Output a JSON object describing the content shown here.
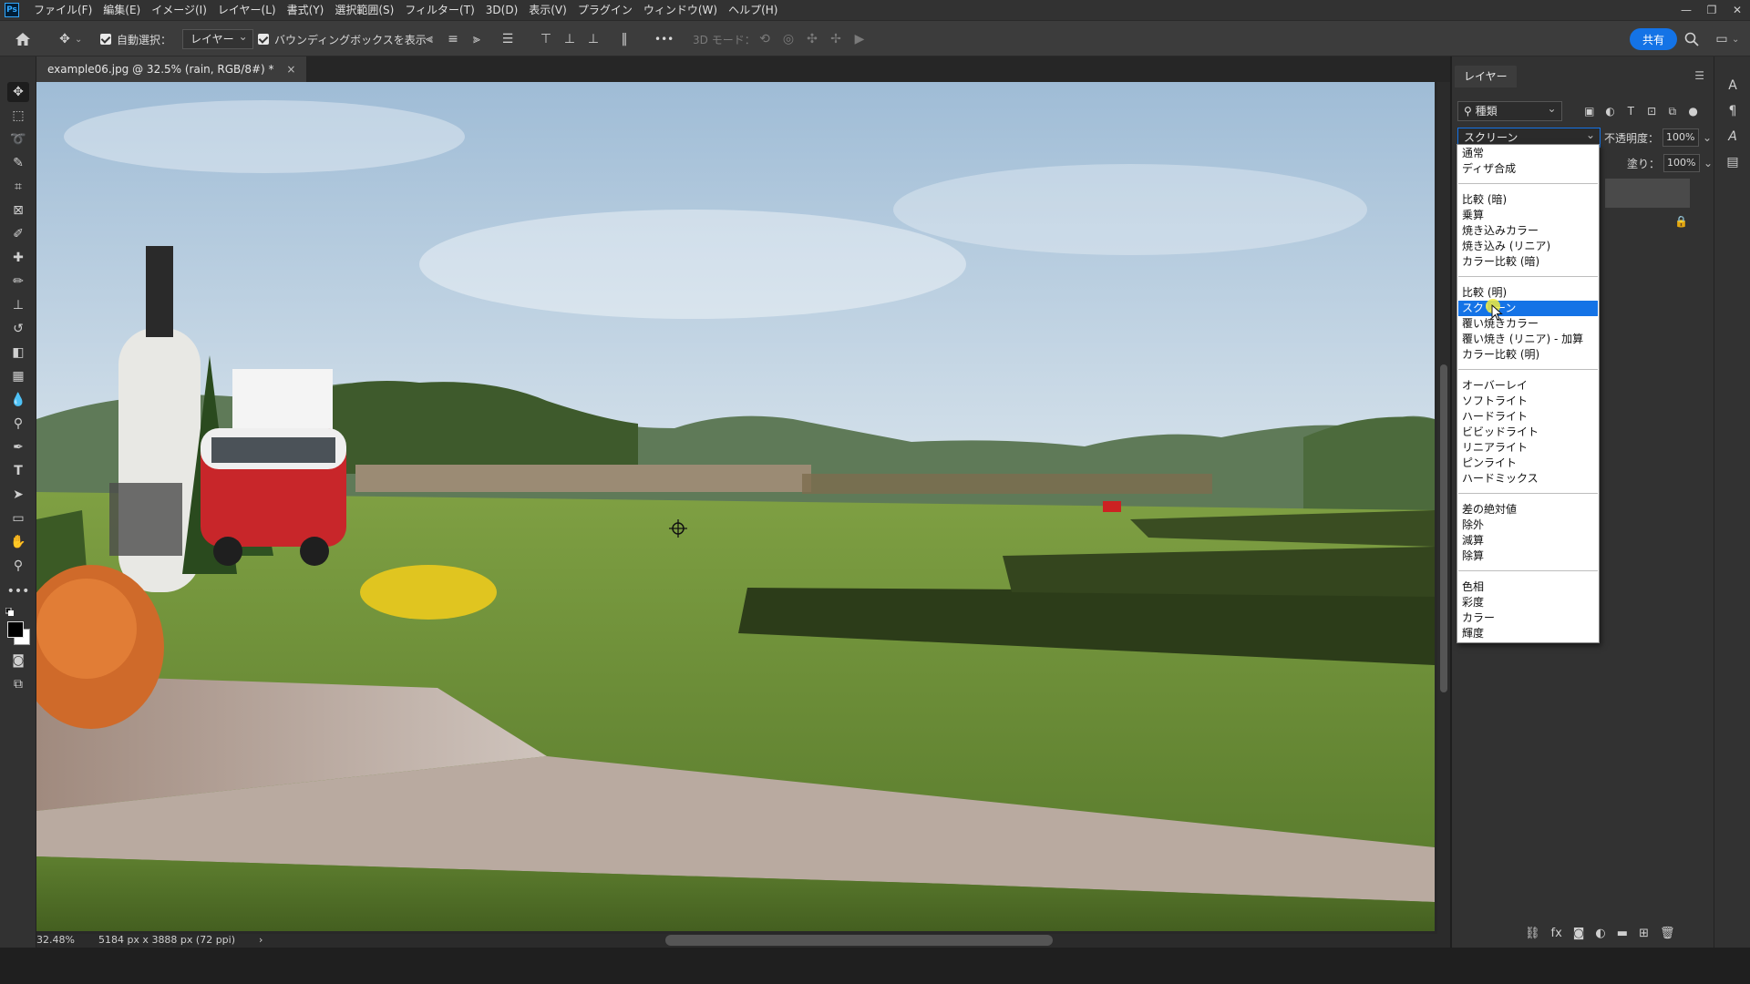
{
  "menubar": {
    "logo": "Ps",
    "items": [
      "ファイル(F)",
      "編集(E)",
      "イメージ(I)",
      "レイヤー(L)",
      "書式(Y)",
      "選択範囲(S)",
      "フィルター(T)",
      "3D(D)",
      "表示(V)",
      "プラグイン",
      "ウィンドウ(W)",
      "ヘルプ(H)"
    ]
  },
  "options": {
    "auto_select_label": "自動選択：",
    "auto_select_target": "レイヤー",
    "bbox_label": "バウンディングボックスを表示",
    "more": "•••",
    "mode_3d": "3D モード：",
    "share": "共有"
  },
  "document": {
    "tab_title": "example06.jpg @ 32.5% (rain, RGB/8#) *",
    "close": "×",
    "zoom": "32.48%",
    "dimensions": "5184 px x 3888 px (72 ppi)",
    "nav_arrow": "›"
  },
  "layers_panel": {
    "title": "レイヤー",
    "kind_filter": "種類",
    "blend_mode": "スクリーン",
    "opacity_label": "不透明度：",
    "opacity_value": "100%",
    "fill_label": "塗り：",
    "fill_value": "100%"
  },
  "blend_menu": {
    "selected": "スクリーン",
    "groups": [
      [
        "通常",
        "ディザ合成"
      ],
      [
        "比較 (暗)",
        "乗算",
        "焼き込みカラー",
        "焼き込み (リニア)",
        "カラー比較 (暗)"
      ],
      [
        "比較 (明)",
        "スクリーン",
        "覆い焼きカラー",
        "覆い焼き (リニア) - 加算",
        "カラー比較 (明)"
      ],
      [
        "オーバーレイ",
        "ソフトライト",
        "ハードライト",
        "ビビッドライト",
        "リニアライト",
        "ピンライト",
        "ハードミックス"
      ],
      [
        "差の絶対値",
        "除外",
        "減算",
        "除算"
      ],
      [
        "色相",
        "彩度",
        "カラー",
        "輝度"
      ]
    ]
  },
  "colors": {
    "accent": "#1473e6",
    "bg_dark": "#323232"
  }
}
